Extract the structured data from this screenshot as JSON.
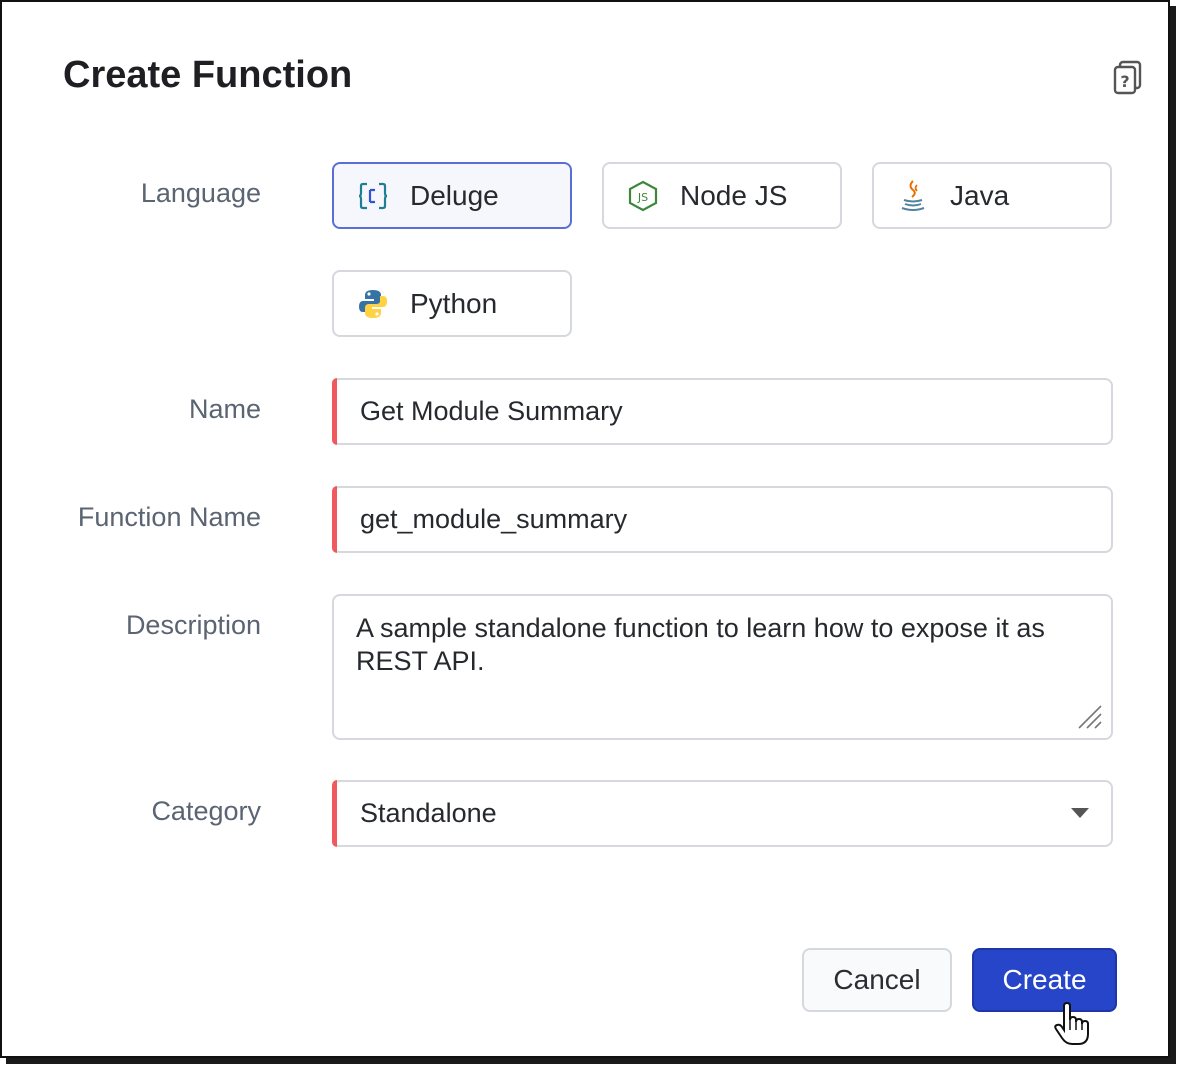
{
  "dialog": {
    "title": "Create Function",
    "help_icon": "help-book-icon"
  },
  "labels": {
    "language": "Language",
    "name": "Name",
    "function_name": "Function Name",
    "description": "Description",
    "category": "Category"
  },
  "languages": [
    {
      "label": "Deluge",
      "icon": "deluge-icon",
      "selected": true
    },
    {
      "label": "Node JS",
      "icon": "nodejs-icon",
      "selected": false
    },
    {
      "label": "Java",
      "icon": "java-icon",
      "selected": false
    },
    {
      "label": "Python",
      "icon": "python-icon",
      "selected": false
    }
  ],
  "fields": {
    "name_value": "Get Module Summary",
    "function_name_value": "get_module_summary",
    "description_value": "A sample standalone function to learn how to expose it as REST API.",
    "category_value": "Standalone"
  },
  "buttons": {
    "cancel": "Cancel",
    "create": "Create"
  },
  "colors": {
    "primary": "#2645c8",
    "required_marker": "#ef5a5f",
    "selected_border": "#5a6fd6"
  }
}
